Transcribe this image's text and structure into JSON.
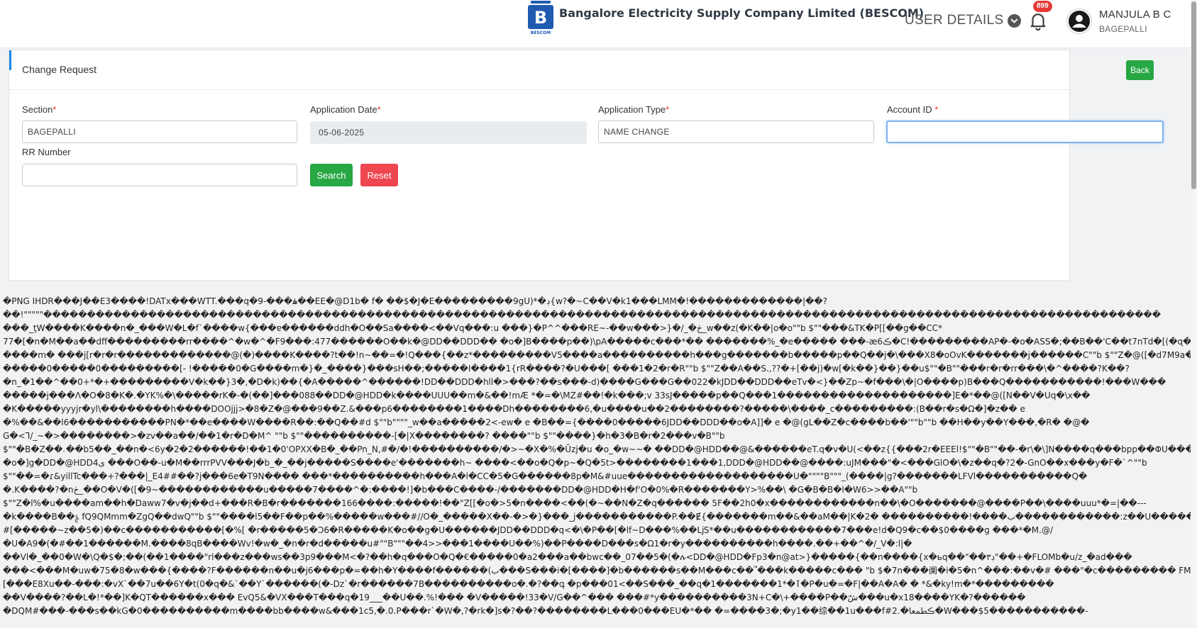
{
  "header": {
    "company_name": "Bangalore Electricity Supply Company Limited (BESCOM)",
    "logo_text": "BESCOM",
    "user_details_label": "USER DETAILS",
    "notification_count": "899",
    "user_name": "MANJULA B C",
    "user_location": "BAGEPALLI"
  },
  "form": {
    "title": "Change Request",
    "back_label": "Back",
    "section_label": "Section",
    "section_value": "BAGEPALLI",
    "application_date_label": "Application Date",
    "application_date_value": "05-06-2025",
    "application_type_label": "Application Type",
    "application_type_value": "NAME CHANGE",
    "account_id_label": "Account ID",
    "account_id_value": "",
    "rr_number_label": "RR Number",
    "rr_number_value": "",
    "required_mark": "*",
    "search_label": "Search",
    "reset_label": "Reset"
  },
  "binary_dump": {
    "lines": [
      "�PNG  IHDR���J��E3����!DATx���WTT.���q�9-���ۿ��EE�@D1b� f� ��$�J�E���������9gU)*�ڊ{w?�~C��V�k1���LMM�!�������������|��?",
      "��!\"\"\"\"\"��������������������������������������������������������������������������������������������������������������������������������",
      "���_ţW����K����n�_���W�L�f`����w{���ɐ������ddh�O��Sa����<��Vq���:u ���}�P^^���RE~-��w���>}�/_�ڂ_w��z(�K��|o�o\"\"b $\"\"���&TK�P[[��g��CC*",
      "77�[�n�M��a��dff���������rr����^�w�^�F9���:477������O��k�@DD��DDD�� �o�]B����p��)\\pA�����c���*�� �������%_�e����� ���-æ6ڪ�C!���������AP�-�o�ASS�;��B��'C��t7nTd�[(�ɋ��A?",
      "����m� ���j[r�r�r�������������@(�)����K����?t��!n~��=�!Q���{��z*���������V5����a����������h���g�������b�����p��Q��j�\\���X8�oOvK�������j������C\"\"b $\"\"Z�@([�d7M9a�ڂ_UH�O��B���B�l5�3F�ug保",
      "�����0�����0���������[- !�����0�G����m�}�_����}���sH��;�����I����1{rR����?�U���[ ���1�2�r�R\"\"b $\"\"Z��A��S.,??�+[��j)�w[�k��}��}��u$\"\"�B\"\"���r�r�rr���\\�^����?K��?",
      "�n_�1��^��0+*�+���������V�k��}3�,�D�k)��{�A�����^������!DD��DDD�hll�>���?��s���-d)����G���G��022�kJDD��DDD��eTv�<}��Zp~�f���\\�|O����p)B���Q�����������!���W���",
      "�����j���Λ�O�8�K�.�YK%�\\�����rK�-�(��]���088��DD�@HDD�k����UUU��m�&��!mÆ *�=�\\MZ#��!�k���;v 33sJ�����p��Q���1��������������������]E�*��@([N��V�Uq�\\x��",
      "�K�����yyyjr�yl\\��������h����DOOjjj>�8�Z�@���9��Z.&���p6��������1����Dh��������6,�u����u��2��������?�����\\����_c���������:(B��r�s�Ω�]�z�� e",
      "�%��&��l6�����������PN�*��e����W����R��:��Q��#d $\"\"b\"\"\"\"_w��a�����2<-ew� e �B��={����0�����6JDD��DDD��o�A]]� e �@(gL��Z�c����b��'\"\"b\"\"b ��H��y��Y���,�R� �@�",
      "G�<Ꞁ/_~�>��������>�zv��a��/��1�r�D�M^ \"\"b $\"\"����������-[�|X��������? ����\"\"b $\"\"����}�h�3�B�r�2���v�B\"\"b",
      "$\"\"�B�Z��ۦ��b5��_��n�<6y�2�2������!��1�0'OPXX�B�_��Pn_N,#�/�!����������/�>~�X�%�Ȗzj�u �o_�w~~� ��DD�@HDD��@&������eT.q�v�U(<��z{{���2r�EEEl!$\"\"�B\"\"��-�r\\�\\]N����q���bpp��ΦU�����JJJ~H�U",
      "�o�]g�DD�@HDD4ى ���O��-u�M��rrrPVV���J�b_�_��j�����S����e'�������h~ ����<��o�Q�p~�Q�5t>��������1���1,DDD�@HDD��@����:uJM���\"�<���GlO�\\�z��q�?2�-GnO��x���y�F�`^\"\"b",
      "$\"\"��=�ɾ&yillTc���+?���|_E4##��?j���6e�T9N���� ���*����������h���A�l�CC�5�G������8p�M&#uue�������������������U�\"\"\"\"B\"\"\"_(����|g?�������LFVl�����������Q�",
      "�.K����?�nڂ_��O�V�([�9~������������u�����7����^�:����!]�b���C����-/�������DD�@HDD�H�f'O�0%�R�������Y>%��\\ �G�B�B�l�W6>>��A\"\"b",
      "$\"\"Z�l%�u����am��h�Daww7�v�j��d+���R�B�r�������166����:�����!��\"Z[[�o�>5�n����<��(�~��N�Z�q������ 5F��2h0�x������������n��\\�O�������@����P��\\����uuu*�=|��---",
      "�k����B��ࣅ fQ9QMmm�ZgQ��dwQ\"\"b $\"\"����l5��F��p��%�����w���#//O�_�����X��-�>�}���_j�����������P.��Ɇ{�������m��&��aM��|K�2� ����������!����ب������������:z��U�����T3��'}",
      "#[�����~z��5�)��c�����������[�%[ �r�����5�Ɔ6�R�����K�o��g�U������JDD��DDD�q<�\\�P��[�lf~D���%��ǈS*��u������������7���e!d�Q9�c��$0����g ���*�M.@/",
      "�U�A9�(�#��1������M.����8qB����Wv!�w�_�n�r�d�����u#\"\"B\"\"\"��4>>���1����U��%)��P����D���s�Ω1�r�y����������h����.��+��^�/_V�:l|�",
      "��Vl�_��0�W�\\Q�$�;��(��1����\"rl���z���ws��3p9���M<�?��h�q���O�Q�€�����0�a2���a��bwc��_07��5�(�ሉ<DD�@HDD�Fp3�n@at>}�����{��n����{x�ьq��\"��ڊ٣\"��+�FLOMb�u/z_�ad���",
      "���<���M�uw�75�8�w���{����?F������n��u�j6���p�=��h�Y����f������(ب���S���i�[����]�b������s��M���c��՞���k�����c��� \"b $�7n���阒�i�5�n^���:��v�# ���\"�c��������� FMvx&a�0h�Zq",
      "[���E8Xu��-���:�vX`��7u��6Y�t(0�q�&`��Y`������(�-Dz`�r������7B����������o�.�?��գ �p���01<��S���_��q�1�������1*�ٱ�P�u�=�F|��A�A� � *&�ky!m�*���������",
      "��V����?��L�!*��]K�QT������x��� EvQ5&�VX���T���q�19___��U��.%!��� �V�����!33�V/G��^��� ���#*y����������3N+C�\\+����P��شّ���u�x18����YK�?������",
      "�DQM#���-���s��kG�0����������m����bb����w&���1c5,�.0.P���r`�W�,?�rk�]s�?��?��������L���0���EU�*�� �=����3�;�y1��综��1u���f#ڪطمعا�.2�W���$5�����������-"
    ]
  }
}
